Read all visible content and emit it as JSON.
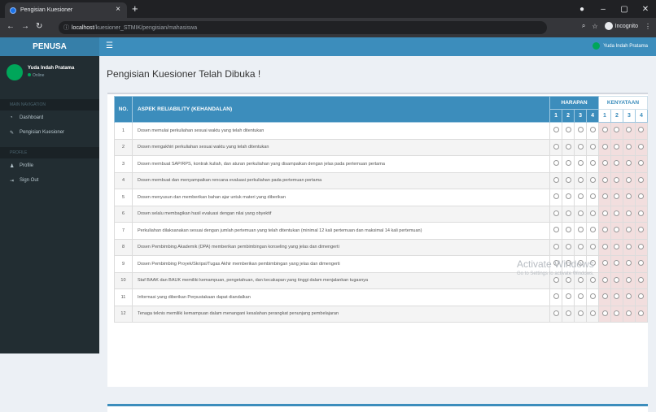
{
  "browser": {
    "tab_title": "Pengisian Kuesioner",
    "host": "localhost",
    "path": "/kuesioner_STMIK/pengisian/mahasiswa",
    "profile": "Incognito"
  },
  "app": {
    "logo": "PENUSA",
    "user_name": "Yuda Indah Pratama",
    "user_status": "Online"
  },
  "sidebar": {
    "header1": "MAIN NAVIGATION",
    "header2": "PROFILE",
    "items": [
      {
        "label": "Dashboard",
        "icon": "dashboard-icon"
      },
      {
        "label": "Pengisian Kuesioner",
        "icon": "edit-icon"
      },
      {
        "label": "Profile",
        "icon": "user-icon"
      },
      {
        "label": "Sign Out",
        "icon": "sign-out-icon"
      }
    ]
  },
  "page": {
    "title": "Pengisian Kuesioner Telah Dibuka !"
  },
  "table": {
    "col_no": "NO.",
    "col_aspect": "ASPEK RELIABILITY (KEHANDALAN)",
    "group_harapan": "HARAPAN",
    "group_kenyataan": "KENYATAAN",
    "scale": [
      "1",
      "2",
      "3",
      "4"
    ],
    "rows": [
      {
        "no": "1",
        "text": "Dosen memulai perkuliahan sesuai waktu yang telah ditentukan"
      },
      {
        "no": "2",
        "text": "Dosen mengakhiri perkuliahan sesuai waktu yang telah ditentukan"
      },
      {
        "no": "3",
        "text": "Dosen membuat SAP/RPS, kontrak kuliah, dan aturan perkuliahan yang disampaikan dengan jelas pada pertemuan pertama"
      },
      {
        "no": "4",
        "text": "Dosen membuat dan menyampaikan rencana evaluasi perkuliahan pada pertemuan pertama"
      },
      {
        "no": "5",
        "text": "Dosen menyusun dan memberikan bahan ajar untuk materi yang diberikan"
      },
      {
        "no": "6",
        "text": "Dosen selalu membagikan hasil evaluasi dengan nilai yang obyektif"
      },
      {
        "no": "7",
        "text": "Perkuliahan dilaksanakan sesuai dengan jumlah pertemuan yang telah ditentukan (minimal 12 kali pertemuan dan maksimal 14 kali pertemuan)"
      },
      {
        "no": "8",
        "text": "Dosen Pembimbing Akademik (DPA) memberikan pembimbingan konseling yang jelas dan dimengerti"
      },
      {
        "no": "9",
        "text": "Dosen Pembimbing Proyek/Skripsi/Tugas Akhir memberikan pembimbingan yang jelas dan dimengerti"
      },
      {
        "no": "10",
        "text": "Staf BAAK dan BAUK memiliki kemampuan, pengetahuan, dan kecakapan yang tinggi dalam menjalankan tugasnya"
      },
      {
        "no": "11",
        "text": "Informasi yang diberikan Perpustakaan dapat diandalkan"
      },
      {
        "no": "12",
        "text": "Tenaga teknis memiliki kemampuan dalam menangani kesalahan perangkat penunjang pembelajaran"
      }
    ]
  },
  "watermark": {
    "line1": "Activate Windows",
    "line2": "Go to Settings to activate Windows."
  },
  "colors": {
    "primary": "#3c8dbc",
    "sidebar": "#222d32",
    "kenyataan_bg": "#f2dede"
  }
}
